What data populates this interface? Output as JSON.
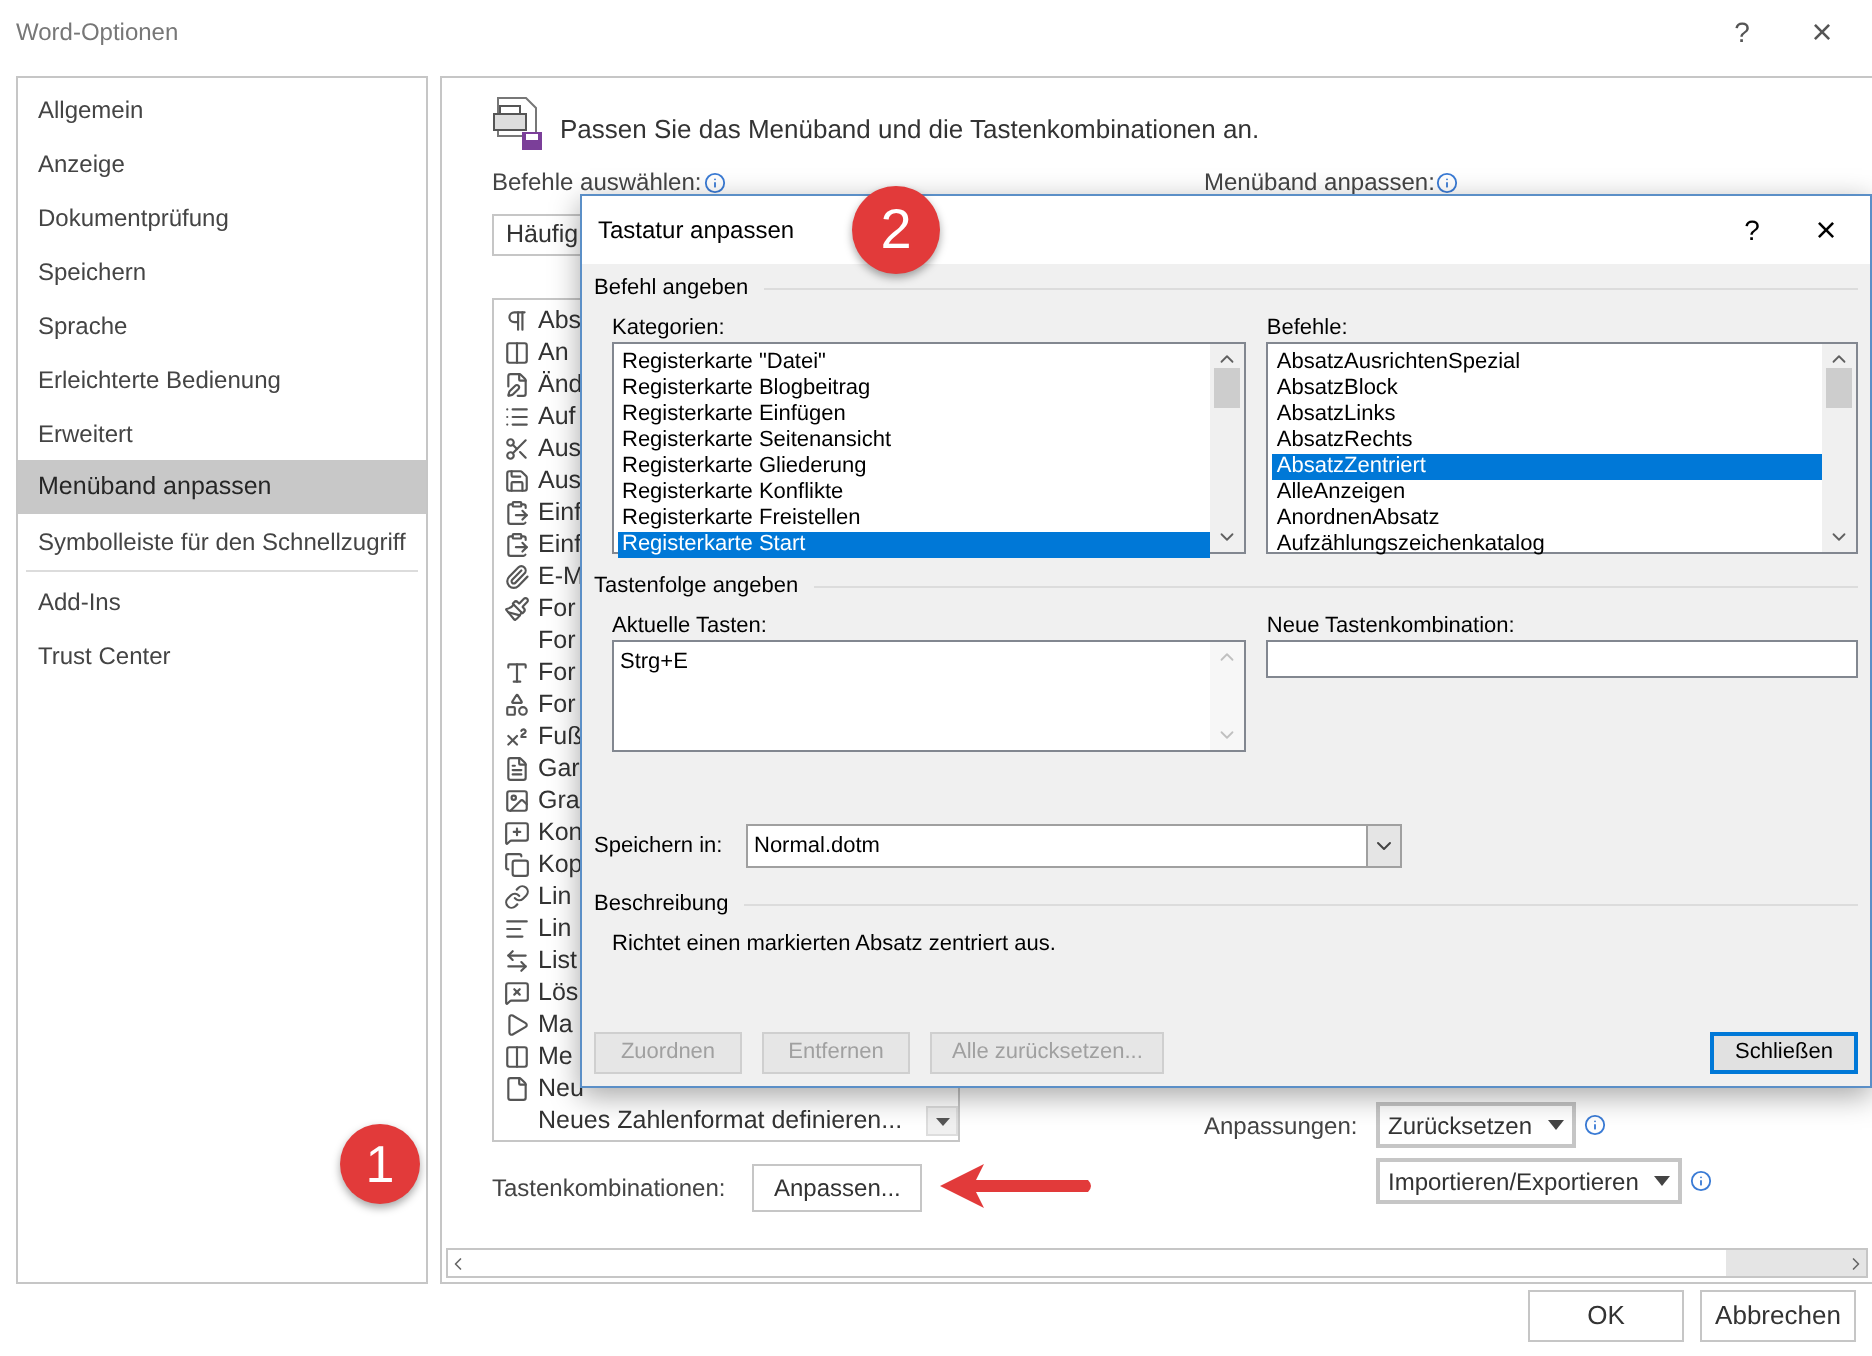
{
  "window": {
    "title": "Word-Optionen",
    "help": "?",
    "close": "×"
  },
  "sidebar": {
    "groups": [
      {
        "items": [
          {
            "label": "Allgemein",
            "selected": false
          },
          {
            "label": "Anzeige",
            "selected": false
          },
          {
            "label": "Dokumentprüfung",
            "selected": false
          },
          {
            "label": "Speichern",
            "selected": false
          },
          {
            "label": "Sprache",
            "selected": false
          },
          {
            "label": "Erleichterte Bedienung",
            "selected": false
          },
          {
            "label": "Erweitert",
            "selected": false
          },
          {
            "label": "Menüband anpassen",
            "selected": true
          },
          {
            "label": "Symbolleiste für den Schnellzugriff",
            "selected": false
          }
        ]
      },
      {
        "items": [
          {
            "label": "Add-Ins",
            "selected": false
          },
          {
            "label": "Trust Center",
            "selected": false
          }
        ]
      }
    ]
  },
  "header": "Passen Sie das Menüband und die Tastenkombinationen an.",
  "commands": {
    "label": "Befehle auswählen:",
    "dropdown": "Häufig",
    "items": [
      {
        "label": "Abs"
      },
      {
        "label": "An"
      },
      {
        "label": "Änd"
      },
      {
        "label": "Auf"
      },
      {
        "label": "Aus"
      },
      {
        "label": "Aus"
      },
      {
        "label": "Einf"
      },
      {
        "label": "Einf"
      },
      {
        "label": "E-M"
      },
      {
        "label": "For"
      },
      {
        "label": "For"
      },
      {
        "label": "For"
      },
      {
        "label": "For"
      },
      {
        "label": "Fuß"
      },
      {
        "label": "Gar"
      },
      {
        "label": "Gra"
      },
      {
        "label": "Kon"
      },
      {
        "label": "Kop"
      },
      {
        "label": "Lin"
      },
      {
        "label": "Lin"
      },
      {
        "label": "List"
      },
      {
        "label": "Lös"
      },
      {
        "label": "Ma"
      },
      {
        "label": "Me"
      },
      {
        "label": "Neu"
      },
      {
        "label": "Neues Zahlenformat definieren..."
      }
    ]
  },
  "ribbon": {
    "label": "Menüband anpassen:",
    "customizations_label": "Anpassungen:",
    "reset_button": "Zurücksetzen",
    "import_export_button": "Importieren/Exportieren"
  },
  "shortcuts": {
    "label": "Tastenkombinationen:",
    "button": "Anpassen..."
  },
  "footer_buttons": [
    "OK",
    "Abbrechen"
  ],
  "annotations": [
    {
      "text": "1"
    },
    {
      "text": "2"
    }
  ],
  "dialog": {
    "title": "Tastatur anpassen",
    "help": "?",
    "close": "×",
    "command_section": "Befehl angeben",
    "categories": {
      "label": "Kategorien:",
      "items": [
        {
          "label": "Registerkarte \"Datei\"",
          "selected": false
        },
        {
          "label": "Registerkarte Blogbeitrag",
          "selected": false
        },
        {
          "label": "Registerkarte Einfügen",
          "selected": false
        },
        {
          "label": "Registerkarte Seitenansicht",
          "selected": false
        },
        {
          "label": "Registerkarte Gliederung",
          "selected": false
        },
        {
          "label": "Registerkarte Konflikte",
          "selected": false
        },
        {
          "label": "Registerkarte Freistellen",
          "selected": false
        },
        {
          "label": "Registerkarte Start",
          "selected": true
        }
      ]
    },
    "commands": {
      "label": "Befehle:",
      "items": [
        {
          "label": "AbsatzAusrichtenSpezial",
          "selected": false
        },
        {
          "label": "AbsatzBlock",
          "selected": false
        },
        {
          "label": "AbsatzLinks",
          "selected": false
        },
        {
          "label": "AbsatzRechts",
          "selected": false
        },
        {
          "label": "AbsatzZentriert",
          "selected": true
        },
        {
          "label": "AlleAnzeigen",
          "selected": false
        },
        {
          "label": "AnordnenAbsatz",
          "selected": false
        },
        {
          "label": "Aufzählungszeichenkatalog",
          "selected": false
        }
      ]
    },
    "keys_section": "Tastenfolge angeben",
    "current_keys": {
      "label": "Aktuelle Tasten:",
      "items": [
        "Strg+E"
      ]
    },
    "new_key": {
      "label": "Neue Tastenkombination:"
    },
    "save_in": {
      "label": "Speichern in:",
      "value": "Normal.dotm"
    },
    "description": {
      "heading": "Beschreibung",
      "text": "Richtet einen markierten Absatz zentriert aus."
    },
    "buttons": [
      {
        "label": "Zuordnen",
        "disabled": true,
        "default": false
      },
      {
        "label": "Entfernen",
        "disabled": true,
        "default": false
      },
      {
        "label": "Alle zurücksetzen...",
        "disabled": true,
        "default": false
      },
      {
        "label": "Schließen",
        "disabled": false,
        "default": true
      }
    ]
  }
}
